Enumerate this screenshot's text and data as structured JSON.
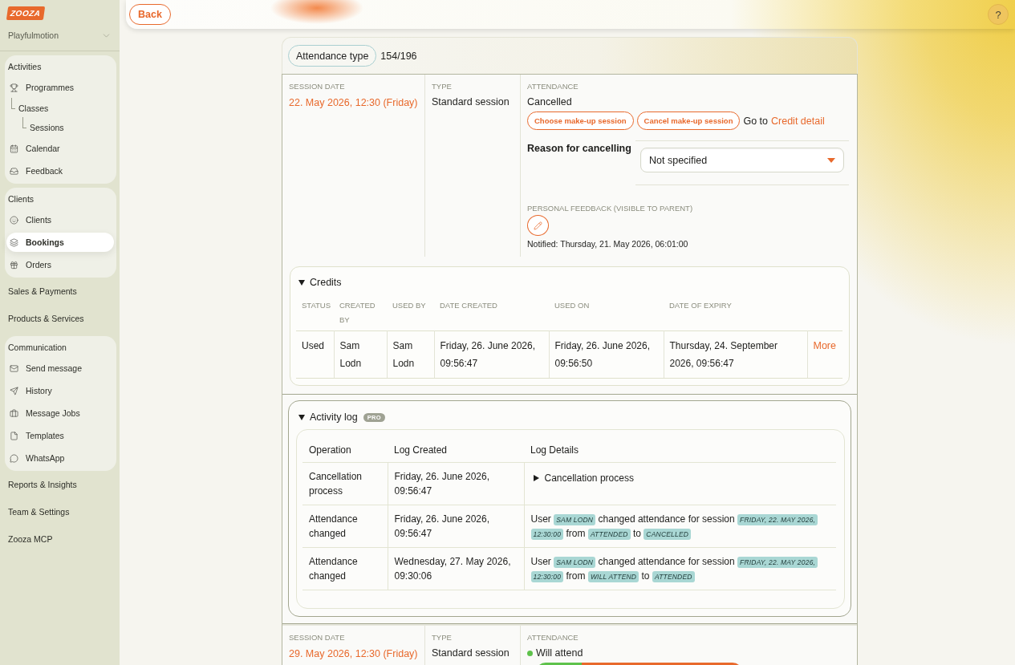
{
  "sidebar": {
    "logo": "ZOOZA",
    "account": "Playfulmotion",
    "sections": [
      {
        "kind": "group",
        "title": "Activities",
        "items": [
          {
            "label": "Programmes",
            "selected": false,
            "children": [
              {
                "label": "Classes",
                "selected": false,
                "children": [
                  {
                    "label": "Sessions",
                    "selected": false
                  }
                ]
              }
            ]
          },
          {
            "label": "Calendar",
            "selected": false
          },
          {
            "label": "Feedback",
            "selected": false
          }
        ]
      },
      {
        "kind": "group",
        "title": "Clients",
        "items": [
          {
            "label": "Clients",
            "selected": false
          },
          {
            "label": "Bookings",
            "selected": true
          },
          {
            "label": "Orders",
            "selected": false
          }
        ]
      },
      {
        "kind": "link",
        "title": "Sales & Payments"
      },
      {
        "kind": "link",
        "title": "Products & Services"
      },
      {
        "kind": "group",
        "title": "Communication",
        "items": [
          {
            "label": "Send message",
            "selected": false
          },
          {
            "label": "History",
            "selected": false
          },
          {
            "label": "Message Jobs",
            "selected": false
          },
          {
            "label": "Templates",
            "selected": false
          },
          {
            "label": "WhatsApp",
            "selected": false
          }
        ]
      },
      {
        "kind": "link",
        "title": "Reports & Insights"
      },
      {
        "kind": "link",
        "title": "Team & Settings"
      },
      {
        "kind": "link",
        "title": "Zooza MCP"
      }
    ]
  },
  "top_bar": {
    "back_button": "Back",
    "help_button": "?"
  },
  "attendance_header": {
    "type_button": "Attendance type",
    "count": "154/196"
  },
  "sessions": [
    {
      "kind": "cancelled",
      "date_label": "SESSION DATE",
      "date": "22. May 2026, 12:30 (Friday)",
      "type_label": "TYPE",
      "type": "Standard session",
      "attendance_label": "ATTENDANCE",
      "attendance": "Cancelled",
      "actions": [
        "Choose make-up session",
        "Cancel make-up session"
      ],
      "credit_prefix": "Go to",
      "credit_link": "Credit detail",
      "reason_label": "Reason for cancelling",
      "reason_value": "Not specified",
      "feedback_label": "PERSONAL FEEDBACK (VISIBLE TO PARENT)",
      "notified": "Notified: Thursday, 21. May 2026, 06:01:00",
      "credits": {
        "title": "Credits",
        "expanded": true,
        "columns": [
          "STATUS",
          "CREATED BY",
          "USED BY",
          "DATE CREATED",
          "USED ON",
          "DATE OF EXPIRY"
        ],
        "rows": [
          {
            "cells": [
              "Used",
              "Sam Lodn",
              "Sam Lodn",
              "Friday, 26. June 2026, 09:56:47",
              "Friday, 26. June 2026, 09:56:50",
              "Thursday, 24. September 2026, 09:56:47"
            ],
            "action": "More"
          }
        ]
      },
      "activity_log": {
        "title": "Activity log",
        "badge": "PRO",
        "expanded": true,
        "columns": [
          "Operation",
          "Log Created",
          "Log Details"
        ],
        "rows": [
          {
            "operation": "Cancellation process",
            "created": "Friday, 26. June 2026, 09:56:47",
            "details": {
              "kind": "disclosure",
              "label": "Cancellation process",
              "expanded": false
            }
          },
          {
            "operation": "Attendance changed",
            "created": "Friday, 26. June 2026, 09:56:47",
            "details": {
              "kind": "sentence",
              "parts": [
                {
                  "kind": "text",
                  "text": "User"
                },
                {
                  "kind": "tag",
                  "text": "SAM LODN"
                },
                {
                  "kind": "text",
                  "text": "changed attendance for session"
                },
                {
                  "kind": "tag",
                  "text": "FRIDAY, 22. MAY 2026, 12:30:00"
                },
                {
                  "kind": "text",
                  "text": "from"
                },
                {
                  "kind": "tag",
                  "text": "ATTENDED"
                },
                {
                  "kind": "text",
                  "text": "to"
                },
                {
                  "kind": "tag",
                  "text": "CANCELLED"
                }
              ]
            }
          },
          {
            "operation": "Attendance changed",
            "created": "Wednesday, 27. May 2026, 09:30:06",
            "details": {
              "kind": "sentence",
              "parts": [
                {
                  "kind": "text",
                  "text": "User"
                },
                {
                  "kind": "tag",
                  "text": "SAM LODN"
                },
                {
                  "kind": "text",
                  "text": "changed attendance for session"
                },
                {
                  "kind": "tag",
                  "text": "FRIDAY, 22. MAY 2026, 12:30:00"
                },
                {
                  "kind": "text",
                  "text": "from"
                },
                {
                  "kind": "tag",
                  "text": "WILL ATTEND"
                },
                {
                  "kind": "text",
                  "text": "to"
                },
                {
                  "kind": "tag",
                  "text": "ATTENDED"
                }
              ]
            }
          }
        ]
      }
    },
    {
      "kind": "scheduled",
      "date_label": "SESSION DATE",
      "date": "29. May 2026, 12:30 (Friday)",
      "type_label": "TYPE",
      "type": "Standard session",
      "attendance_label": "ATTENDANCE",
      "attendance": "Will attend",
      "color": "#5ec24b"
    }
  ]
}
